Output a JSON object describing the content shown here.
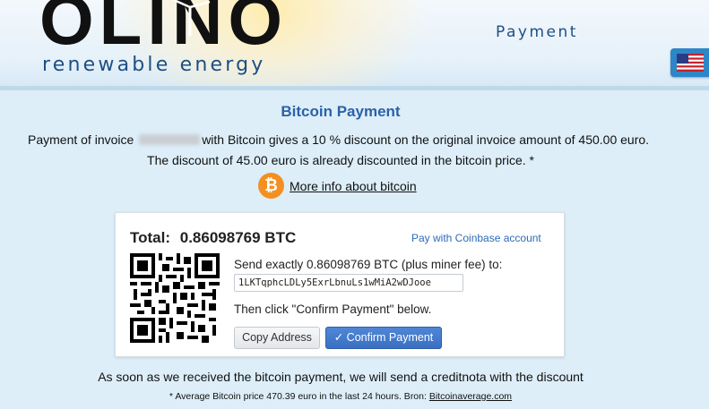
{
  "header": {
    "logo_text": "OLINO",
    "tagline": "renewable energy",
    "page_label": "Payment",
    "language_flag": "us-flag-icon"
  },
  "content": {
    "title": "Bitcoin Payment",
    "line1_prefix": "Payment of invoice",
    "line1_suffix": "with Bitcoin gives a 10 % discount on the original invoice amount of 450.00 euro.",
    "line2": "The discount of 45.00 euro is already discounted in the bitcoin price. *",
    "more_info_link": "More info about bitcoin",
    "bitcoin_icon_glyph": "₿"
  },
  "payment_card": {
    "total_label": "Total:",
    "total_amount": "0.86098769 BTC",
    "coinbase_link": "Pay with Coinbase account",
    "send_instruction": "Send exactly 0.86098769 BTC (plus miner fee) to:",
    "address": "1LKTqphcLDLy5ExrLbnuLs1wMiA2wDJooe",
    "then_instruction": "Then click \"Confirm Payment\" below.",
    "copy_button": "Copy Address",
    "confirm_button": "✓ Confirm Payment"
  },
  "footer": {
    "notice": "As soon as we received the bitcoin payment, we will send a creditnota with the discount",
    "footnote_prefix": "* Average Bitcoin price 470.39 euro in the last 24 hours. Bron:",
    "footnote_link": "Bitcoinaverage.com"
  },
  "colors": {
    "background": "#ddeef9",
    "brand_blue": "#1d4f86",
    "title_blue": "#2c62a5",
    "bitcoin_orange": "#f39021",
    "confirm_blue": "#3a70c2"
  }
}
